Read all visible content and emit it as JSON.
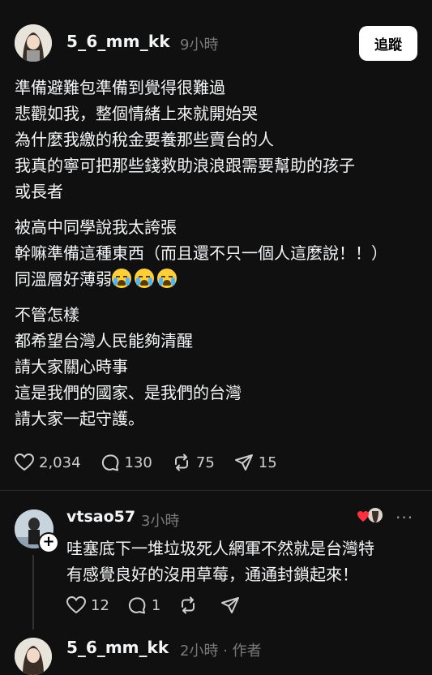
{
  "post": {
    "author": "5_6_mm_kk",
    "time": "9小時",
    "follow_label": "追蹤",
    "paragraphs": [
      [
        "準備避難包準備到覺得很難過",
        "悲觀如我，整個情緒上來就開始哭",
        "為什麼我繳的稅金要養那些賣台的人",
        "我真的寧可把那些錢救助浪浪跟需要幫助的孩子",
        "或長者"
      ],
      [
        "被高中同學說我太誇張",
        "幹嘛準備這種東西（而且還不只一個人這麼說！！）",
        "同溫層好薄弱"
      ],
      [
        "不管怎樣",
        "都希望台灣人民能夠清醒",
        "請大家關心時事",
        "這是我們的國家、是我們的台灣",
        "請大家一起守護。"
      ]
    ],
    "likes": "2,034",
    "comments": "130",
    "reposts": "75",
    "shares": "15"
  },
  "reply": {
    "author": "vtsao57",
    "time": "3小時",
    "text_lines": [
      "哇塞底下一堆垃圾死人網軍不然就是台灣特",
      "有感覺良好的沒用草莓，通通封鎖起來！"
    ],
    "likes": "12",
    "comments": "1",
    "more": "···"
  },
  "next": {
    "author": "5_6_mm_kk",
    "meta": "2小時 · 作者"
  },
  "icons": {
    "heart": "heart-icon",
    "comment": "comment-icon",
    "repost": "repost-icon",
    "share": "share-icon"
  },
  "colors": {
    "background": "#101010",
    "text": "#f3f5f7",
    "muted": "#7a7a7a",
    "like_badge": "#ff3040"
  }
}
